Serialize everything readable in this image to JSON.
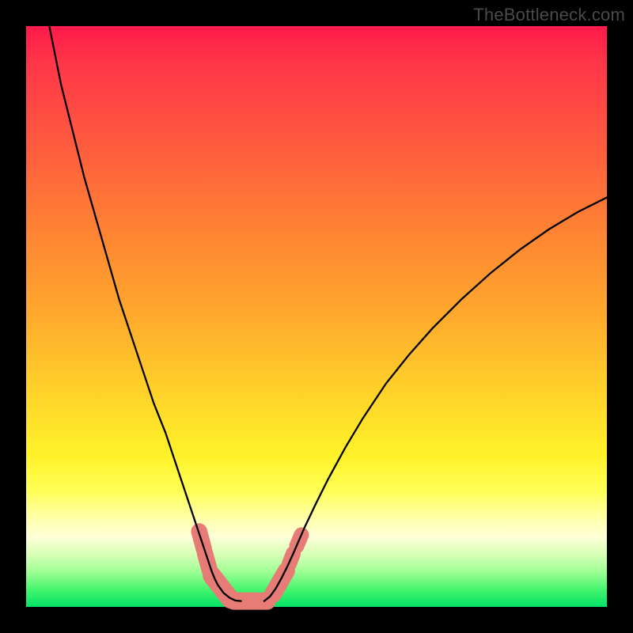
{
  "watermark": "TheBottleneck.com",
  "chart_data": {
    "type": "line",
    "title": "",
    "xlabel": "",
    "ylabel": "",
    "xlim": [
      0,
      100
    ],
    "ylim": [
      0,
      100
    ],
    "series": [
      {
        "name": "left-curve",
        "x": [
          4,
          5,
          6,
          8,
          10,
          12,
          14,
          16,
          18,
          20,
          22,
          24,
          26,
          27,
          28,
          29,
          30,
          30.5,
          31,
          31.5,
          32,
          32.5,
          33,
          34,
          35,
          36,
          37
        ],
        "y": [
          100,
          95,
          90,
          82,
          74,
          67,
          60,
          53,
          47,
          41,
          35,
          30,
          24,
          21,
          18,
          15,
          12,
          10.5,
          9,
          7.5,
          6,
          4.8,
          3.8,
          2.4,
          1.6,
          1.1,
          1.0
        ]
      },
      {
        "name": "right-curve",
        "x": [
          41,
          42,
          43,
          44,
          45,
          46,
          47,
          48,
          50,
          52,
          55,
          58,
          62,
          66,
          70,
          75,
          80,
          85,
          90,
          95,
          100
        ],
        "y": [
          1.0,
          1.8,
          3.2,
          5.0,
          7.0,
          9.2,
          11.5,
          13.8,
          18.0,
          22.0,
          27.5,
          32.5,
          38.5,
          43.5,
          48.0,
          53.0,
          57.5,
          61.5,
          65.0,
          68.0,
          70.5
        ]
      }
    ],
    "markers": {
      "name": "bottom-lozenges",
      "color": "#e77c76",
      "segments": [
        {
          "x1": 29.8,
          "y1": 13.0,
          "x2": 30.6,
          "y2": 10.0,
          "w": 2.8
        },
        {
          "x1": 30.8,
          "y1": 9.2,
          "x2": 31.6,
          "y2": 6.3,
          "w": 2.8
        },
        {
          "x1": 32.0,
          "y1": 5.4,
          "x2": 35.2,
          "y2": 1.3,
          "w": 3.2
        },
        {
          "x1": 35.8,
          "y1": 1.0,
          "x2": 41.5,
          "y2": 1.0,
          "w": 3.0
        },
        {
          "x1": 42.5,
          "y1": 2.2,
          "x2": 44.8,
          "y2": 6.2,
          "w": 3.0
        },
        {
          "x1": 45.3,
          "y1": 7.4,
          "x2": 46.0,
          "y2": 9.2,
          "w": 2.6
        },
        {
          "x1": 46.6,
          "y1": 10.5,
          "x2": 47.4,
          "y2": 12.4,
          "w": 2.6
        }
      ]
    }
  }
}
